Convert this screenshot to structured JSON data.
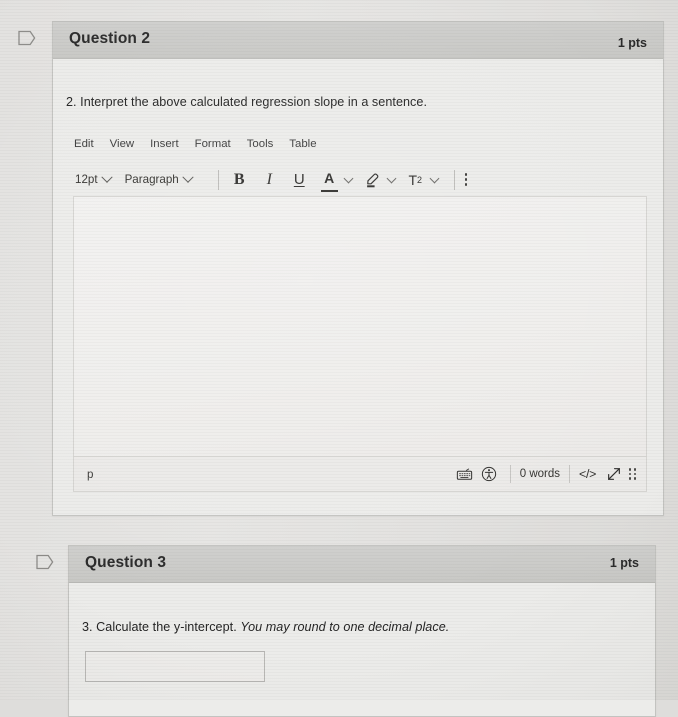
{
  "page": {
    "background_color": "#e3e2e0",
    "card_background": "#ececeb",
    "header_background": "#c9c9c6"
  },
  "questions": [
    {
      "flag_icon": "bookmark-flag-icon",
      "title": "Question 2",
      "points": "1 pts",
      "prompt_plain": "2. Interpret the above calculated regression slope in a sentence.",
      "prompt_italic": "",
      "answer_type": "rich-content-editor",
      "editor": {
        "menubar": [
          "Edit",
          "View",
          "Insert",
          "Format",
          "Tools",
          "Table"
        ],
        "toolbar": {
          "font_size": "12pt",
          "block_format": "Paragraph",
          "bold_label": "B",
          "italic_label": "I",
          "underline_label": "U",
          "text_color_label": "A",
          "highlight_icon": "highlighter-pen-icon",
          "superscript_label": "T",
          "superscript_exponent": "2",
          "more_icon": "kebab-more-icon"
        },
        "content": "",
        "statusbar": {
          "element_path": "p",
          "keyboard_icon": "keyboard-shortcuts-icon",
          "accessibility_icon": "accessibility-checker-icon",
          "word_count": "0 words",
          "html_editor_label": "</>",
          "fullscreen_icon": "expand-arrow-icon",
          "resize_icon": "resize-grip-icon"
        }
      }
    },
    {
      "flag_icon": "bookmark-flag-icon",
      "title": "Question 3",
      "points": "1 pts",
      "prompt_plain": "3. Calculate the y-intercept.",
      "prompt_italic": "You may round to one decimal place.",
      "answer_type": "short-answer-input",
      "answer_value": "",
      "answer_placeholder": ""
    }
  ]
}
